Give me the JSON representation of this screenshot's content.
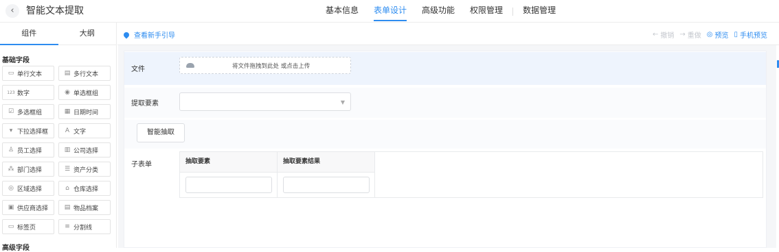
{
  "header": {
    "back_icon": "‹",
    "title": "智能文本提取",
    "tabs": [
      {
        "label": "基本信息"
      },
      {
        "label": "表单设计"
      },
      {
        "label": "高级功能"
      },
      {
        "label": "权限管理"
      },
      {
        "label": "数据管理"
      }
    ],
    "active_tab": "表单设计",
    "accent": "#2d8cf0"
  },
  "sidebar": {
    "tabs": [
      {
        "label": "组件"
      },
      {
        "label": "大纲"
      }
    ],
    "section_basic": "基础字段",
    "section_advanced": "高级字段",
    "fields": [
      {
        "label": "单行文本",
        "icon": "▭"
      },
      {
        "label": "多行文本",
        "icon": "▤"
      },
      {
        "label": "数字",
        "icon": "123"
      },
      {
        "label": "单选框组",
        "icon": "◉"
      },
      {
        "label": "多选框组",
        "icon": "☑"
      },
      {
        "label": "日期时间",
        "icon": "▦"
      },
      {
        "label": "下拉选择框",
        "icon": "▾"
      },
      {
        "label": "文字",
        "icon": "A"
      },
      {
        "label": "员工选择",
        "icon": "♙"
      },
      {
        "label": "公司选择",
        "icon": "▥"
      },
      {
        "label": "部门选择",
        "icon": "⁂"
      },
      {
        "label": "资产分类",
        "icon": "☰"
      },
      {
        "label": "区域选择",
        "icon": "◎"
      },
      {
        "label": "仓库选择",
        "icon": "⌂"
      },
      {
        "label": "供应商选择",
        "icon": "▣"
      },
      {
        "label": "物品档案",
        "icon": "▤"
      },
      {
        "label": "标签页",
        "icon": "▭"
      },
      {
        "label": "分割线",
        "icon": "≡"
      }
    ]
  },
  "toolbar": {
    "guide": "查看新手引导",
    "undo": "撤销",
    "redo": "重做",
    "preview": "预览",
    "mobile_preview": "手机预览"
  },
  "form": {
    "file_label": "文件",
    "upload_text": "将文件拖拽到此处 或点击上传",
    "extract_label": "提取要素",
    "extract_button": "智能抽取",
    "subform_label": "子表单",
    "subform_columns": [
      {
        "header": "抽取要素"
      },
      {
        "header": "抽取要素结果"
      }
    ]
  }
}
